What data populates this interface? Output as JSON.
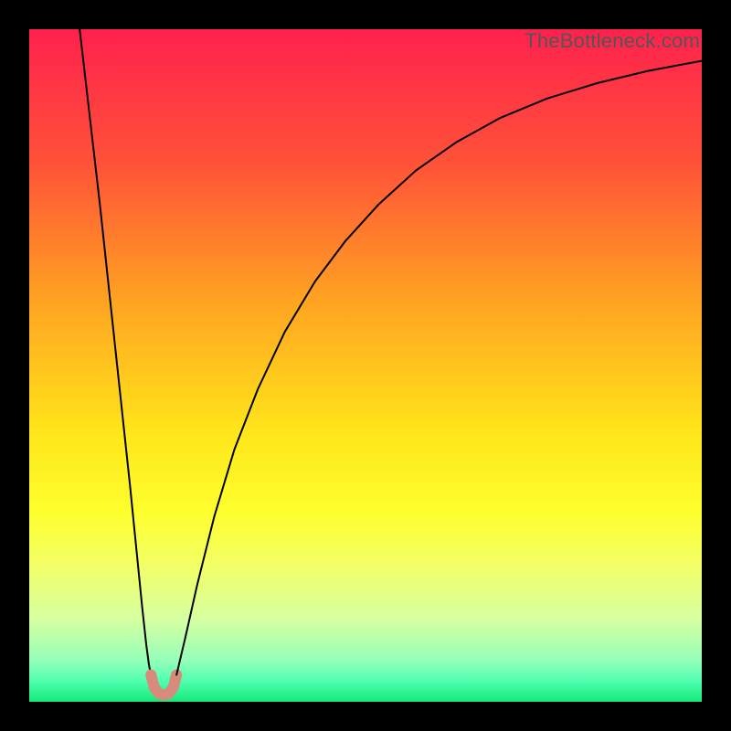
{
  "watermark": "TheBottleneck.com",
  "chart_data": {
    "type": "line",
    "title": "",
    "xlabel": "",
    "ylabel": "",
    "xlim": [
      0,
      1
    ],
    "ylim": [
      0,
      1
    ],
    "grid": false,
    "legend": null,
    "gradient": [
      {
        "pos": 0.0,
        "color": "#ff214d"
      },
      {
        "pos": 0.2,
        "color": "#ff5238"
      },
      {
        "pos": 0.4,
        "color": "#ffa222"
      },
      {
        "pos": 0.6,
        "color": "#ffe61a"
      },
      {
        "pos": 0.72,
        "color": "#feff2e"
      },
      {
        "pos": 0.8,
        "color": "#f2ff68"
      },
      {
        "pos": 0.88,
        "color": "#d5ffa2"
      },
      {
        "pos": 0.94,
        "color": "#92ffba"
      },
      {
        "pos": 0.97,
        "color": "#4dffaf"
      },
      {
        "pos": 1.0,
        "color": "#17e87b"
      }
    ],
    "series": [
      {
        "name": "left-branch",
        "color": "#000000",
        "width": 2,
        "x": [
          0.075,
          0.09,
          0.105,
          0.12,
          0.135,
          0.15,
          0.16,
          0.168,
          0.174,
          0.178,
          0.181
        ],
        "y": [
          1.0,
          0.87,
          0.74,
          0.6,
          0.46,
          0.32,
          0.22,
          0.14,
          0.085,
          0.055,
          0.04
        ]
      },
      {
        "name": "dip-segment",
        "color": "#d98b7b",
        "width": 12,
        "x": [
          0.181,
          0.186,
          0.193,
          0.2,
          0.207,
          0.214,
          0.219
        ],
        "y": [
          0.04,
          0.021,
          0.012,
          0.01,
          0.012,
          0.021,
          0.04
        ]
      },
      {
        "name": "right-branch",
        "color": "#000000",
        "width": 2,
        "x": [
          0.219,
          0.232,
          0.25,
          0.275,
          0.305,
          0.34,
          0.38,
          0.425,
          0.47,
          0.52,
          0.575,
          0.635,
          0.7,
          0.77,
          0.845,
          0.92,
          1.0
        ],
        "y": [
          0.04,
          0.095,
          0.175,
          0.275,
          0.375,
          0.465,
          0.55,
          0.625,
          0.685,
          0.74,
          0.79,
          0.832,
          0.868,
          0.897,
          0.92,
          0.938,
          0.953
        ]
      }
    ]
  }
}
